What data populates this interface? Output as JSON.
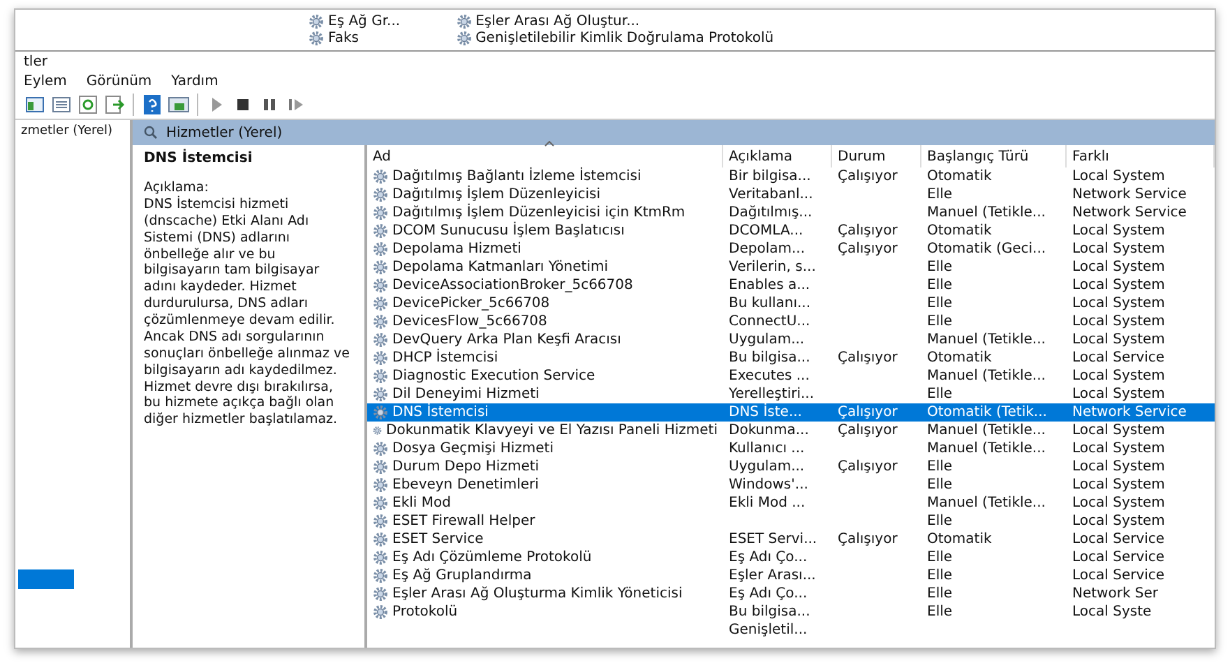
{
  "background_window": {
    "items": [
      "Eş Ağ Gr...",
      "Eşler Arası Ağ Oluştur...",
      "Faks",
      "Genişletilebilir Kimlik Doğrulama Protokolü"
    ]
  },
  "window": {
    "title": "tler"
  },
  "menu": [
    "Eylem",
    "Görünüm",
    "Yardım"
  ],
  "tree": {
    "items": [
      {
        "label": "zmetler (Yerel)",
        "selected": false
      }
    ]
  },
  "detail": {
    "header": "Hizmetler (Yerel)",
    "title": "DNS İstemcisi",
    "description_label": "Açıklama:",
    "description": "DNS İstemcisi hizmeti (dnscache) Etki Alanı Adı Sistemi (DNS) adlarını önbelleğe alır ve bu bilgisayarın tam bilgisayar adını kaydeder. Hizmet durdurulursa, DNS adları çözümlenmeye devam edilir. Ancak DNS adı sorgularının sonuçları önbelleğe alınmaz ve bilgisayarın adı kaydedilmez. Hizmet devre dışı bırakılırsa, bu hizmete açıkça bağlı olan diğer hizmetler başlatılamaz."
  },
  "table": {
    "columns": [
      {
        "label": "Ad",
        "sorted": true
      },
      {
        "label": "Açıklama",
        "sorted": false
      },
      {
        "label": "Durum",
        "sorted": false
      },
      {
        "label": "Başlangıç Türü",
        "sorted": false
      },
      {
        "label": "Farklı",
        "sorted": false
      }
    ],
    "rows": [
      {
        "name": "Dağıtılmış Bağlantı İzleme İstemcisi",
        "description": "Bir bilgisa...",
        "status": "Çalışıyor",
        "startup": "Otomatik",
        "logon": "Local System",
        "selected": false
      },
      {
        "name": "Dağıtılmış İşlem Düzenleyicisi",
        "description": "Veritabanl...",
        "startup": "Elle",
        "logon": "Network Service",
        "selected": false
      },
      {
        "name": "Dağıtılmış İşlem Düzenleyicisi için KtmRm",
        "description": "Dağıtılmış...",
        "startup": "Manuel (Tetikle...",
        "logon": "Network Service",
        "selected": false
      },
      {
        "name": "DCOM Sunucusu İşlem Başlatıcısı",
        "description": "DCOMLA...",
        "status": "Çalışıyor",
        "startup": "Otomatik",
        "logon": "Local System",
        "selected": false
      },
      {
        "name": "Depolama Hizmeti",
        "description": "Depolam...",
        "status": "Çalışıyor",
        "startup": "Otomatik (Geci...",
        "logon": "Local System",
        "selected": false
      },
      {
        "name": "Depolama Katmanları Yönetimi",
        "description": "Verilerin, s...",
        "startup": "Elle",
        "logon": "Local System",
        "selected": false
      },
      {
        "name": "DeviceAssociationBroker_5c66708",
        "description": "Enables a...",
        "startup": "Elle",
        "logon": "Local System",
        "selected": false
      },
      {
        "name": "DevicePicker_5c66708",
        "description": "Bu kullanı...",
        "startup": "Elle",
        "logon": "Local System",
        "selected": false
      },
      {
        "name": "DevicesFlow_5c66708",
        "description": "ConnectU...",
        "startup": "Elle",
        "logon": "Local System",
        "selected": false
      },
      {
        "name": "DevQuery Arka Plan Keşfi Aracısı",
        "description": "Uygulam...",
        "startup": "Manuel (Tetikle...",
        "logon": "Local System",
        "selected": false
      },
      {
        "name": "DHCP İstemcisi",
        "description": "Bu bilgisa...",
        "status": "Çalışıyor",
        "startup": "Otomatik",
        "logon": "Local Service",
        "selected": false
      },
      {
        "name": "Diagnostic Execution Service",
        "description": "Executes ...",
        "startup": "Manuel (Tetikle...",
        "logon": "Local System",
        "selected": false
      },
      {
        "name": "Dil Deneyimi Hizmeti",
        "description": "Yerelleştiri...",
        "startup": "Elle",
        "logon": "Local System",
        "selected": false
      },
      {
        "name": "DNS İstemcisi",
        "description": "DNS İste...",
        "status": "Çalışıyor",
        "startup": "Otomatik (Tetik...",
        "logon": "Network Service",
        "selected": true
      },
      {
        "name": "Dokunmatik Klavyeyi ve El Yazısı Paneli Hizmeti",
        "description": "Dokunma...",
        "status": "Çalışıyor",
        "startup": "Manuel (Tetikle...",
        "logon": "Local System",
        "selected": false
      },
      {
        "name": "Dosya Geçmişi Hizmeti",
        "description": "Kullanıcı ...",
        "startup": "Manuel (Tetikle...",
        "logon": "Local System",
        "selected": false
      },
      {
        "name": "Durum Depo Hizmeti",
        "description": "Uygulam...",
        "status": "Çalışıyor",
        "startup": "Elle",
        "logon": "Local System",
        "selected": false
      },
      {
        "name": "Ebeveyn Denetimleri",
        "description": "Windows'...",
        "startup": "Elle",
        "logon": "Local System",
        "selected": false
      },
      {
        "name": "Ekli Mod",
        "description": "Ekli Mod ...",
        "startup": "Manuel (Tetikle...",
        "logon": "Local System",
        "selected": false
      },
      {
        "name": "ESET Firewall Helper",
        "startup": "Elle",
        "logon": "Local System",
        "selected": false
      },
      {
        "name": "ESET Service",
        "description": "ESET Servi...",
        "status": "Çalışıyor",
        "startup": "Otomatik",
        "logon": "Local Service",
        "selected": false
      },
      {
        "name": "Eş Adı Çözümleme Protokolü",
        "description": "Eş Adı Ço...",
        "startup": "Elle",
        "logon": "Local Service",
        "selected": false
      },
      {
        "name": "Eş Ağ Gruplandırma",
        "description": "Eşler Arası...",
        "startup": "Elle",
        "logon": "Local Service",
        "selected": false
      },
      {
        "name": "Eşler Arası Ağ Oluşturma Kimlik Yöneticisi",
        "description": "Eş Adı Ço...",
        "startup": "Elle",
        "logon": "Network Ser",
        "selected": false
      },
      {
        "name": "Protokolü",
        "description": "Bu bilgisa...",
        "startup": "Elle",
        "logon": "Local Syste",
        "selected": false
      },
      {
        "description": "Genişletil...",
        "selected": false
      }
    ]
  }
}
